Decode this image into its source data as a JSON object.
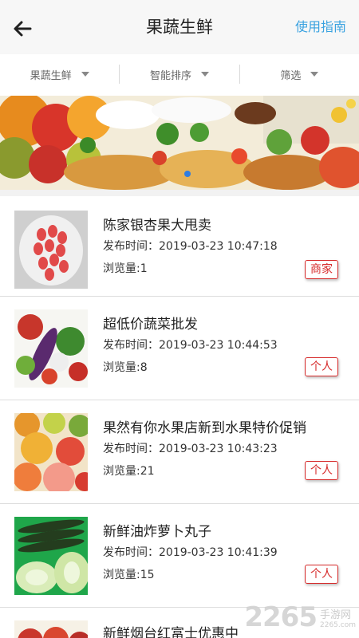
{
  "header": {
    "title": "果蔬生鲜",
    "guide_label": "使用指南",
    "back_icon": "arrow-left-icon"
  },
  "filters": [
    {
      "label": "果蔬生鲜"
    },
    {
      "label": "智能排序"
    },
    {
      "label": "筛选"
    }
  ],
  "banner": {
    "image": "fresh-fruit-vegetable-food-banner",
    "indicator_color": "#2f7de1"
  },
  "items": [
    {
      "title": "陈家银杏果大甩卖",
      "time": "发布时间：2019-03-23 10:47:18",
      "views": "浏览量:1",
      "badge": "商家",
      "thumb": "red-fruit-plate"
    },
    {
      "title": "超低价蔬菜批发",
      "time": "发布时间：2019-03-23 10:44:53",
      "views": "浏览量:8",
      "badge": "个人",
      "thumb": "vegetables"
    },
    {
      "title": "果然有你水果店新到水果特价促销",
      "time": "发布时间：2019-03-23 10:43:23",
      "views": "浏览量:21",
      "badge": "个人",
      "thumb": "citrus-fruits"
    },
    {
      "title": "新鲜油炸萝卜丸子",
      "time": "发布时间：2019-03-23 10:41:39",
      "views": "浏览量:15",
      "badge": "个人",
      "thumb": "cucumber-cabbage"
    },
    {
      "title": "新鲜烟台红富士优惠中",
      "thumb": "apples"
    }
  ],
  "watermark": {
    "number": "2265",
    "text": "手游网",
    "url": "2265.com"
  },
  "colors": {
    "accent": "#3aa2e0",
    "badge": "#d62a2a"
  }
}
